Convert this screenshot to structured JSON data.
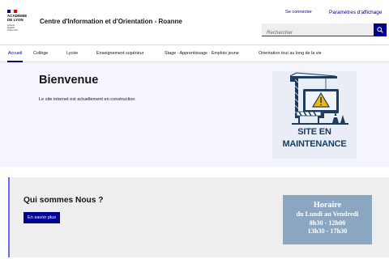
{
  "header": {
    "logo": {
      "line1": "ACADÉMIE",
      "line2": "DE LYON",
      "motto": [
        "Liberté",
        "Égalité",
        "Fraternité"
      ],
      "flag_colors": [
        "#000091",
        "#ffffff",
        "#e1000f"
      ]
    },
    "site_title": "Centre d'Information et d'Orientation - Roanne",
    "connect_label": "Se connecter",
    "params_label": "Paramètres d'affichage",
    "search_placeholder": "Rechercher",
    "search_icon": "search-icon"
  },
  "nav": {
    "items": [
      {
        "label": "Accueil",
        "active": true
      },
      {
        "label": "Collège",
        "active": false
      },
      {
        "label": "Lycée",
        "active": false
      },
      {
        "label": "Enseignement supérieur",
        "active": false
      },
      {
        "label": "Stage - Apprentissage - Emplois jeune",
        "active": false
      },
      {
        "label": "Orientation tout au long de la vie",
        "active": false
      }
    ]
  },
  "hero": {
    "title": "Bienvenue",
    "text": "Le site internet est actuellement en construction",
    "maintenance_image": {
      "line1": "SITE EN",
      "line2": "MAINTENANCE"
    }
  },
  "about": {
    "title": "Qui sommes Nous ?",
    "button_label": "En savoir plus"
  },
  "hours": {
    "title": "Horaire",
    "days": "du Lundi au Vendredi",
    "morning": "8h30 - 12h00",
    "afternoon": "13h30 - 17h30"
  },
  "colors": {
    "accent": "#000091",
    "hero_bg": "#f5f5fe",
    "about_bg": "#eeeeee",
    "about_border": "#6a6af4",
    "hours_bg": "#8ba6c0"
  }
}
